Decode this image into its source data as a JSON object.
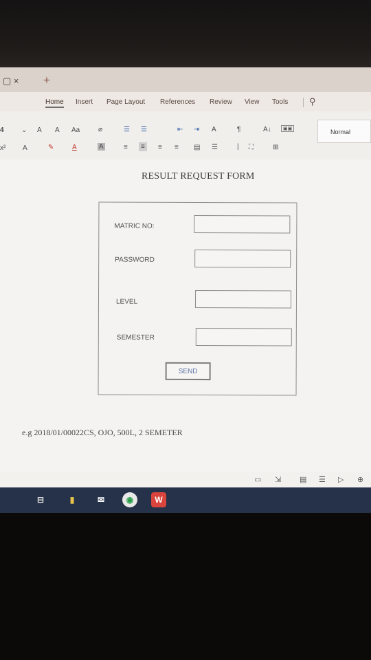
{
  "window": {
    "close_tab_icons": "▢ ×",
    "new_tab_label": "+"
  },
  "menu": {
    "items": [
      "Home",
      "Insert",
      "Page Layout",
      "References",
      "Review",
      "View",
      "Tools"
    ]
  },
  "ribbon": {
    "font_size": "4",
    "grow_font": "A",
    "shrink_font": "A",
    "change_case": "Aa",
    "clear_format": "⌀",
    "row2_script": "x²",
    "font_color_a": "A",
    "highlight": "✎",
    "char_shading": "A",
    "char_border": "A",
    "bullets": "☰",
    "numbering": "☰",
    "indent_dec": "⇤",
    "indent_inc": "⇥",
    "asian_layout": "A",
    "para_mark": "¶",
    "sort": "A↓",
    "align_left": "≡",
    "align_center": "≡",
    "align_right": "≡",
    "justify": "≡",
    "distribute": "▤",
    "line_spacing": "☰",
    "shading": "⛶",
    "borders": "⊞",
    "style_name": "Normal"
  },
  "document": {
    "title": "RESULT REQUEST FORM",
    "fields": [
      {
        "label": "MATRIC NO:",
        "value": ""
      },
      {
        "label": "PASSWORD",
        "value": ""
      },
      {
        "label": "LEVEL",
        "value": ""
      },
      {
        "label": "SEMESTER",
        "value": ""
      }
    ],
    "send_label": "SEND",
    "example": "e.g 2018/01/00022CS, OJO, 500L, 2 SEMETER"
  },
  "statusbar": {
    "icons": [
      "▭",
      "⇲",
      "▤",
      "☰",
      "▷",
      "⊕"
    ]
  },
  "taskbar": {
    "icons": [
      "⊟",
      "▮",
      "✉",
      "◉",
      "W"
    ]
  },
  "colors": {
    "taskbar": "#26324a",
    "app_bg": "#e9e6e2",
    "send_text": "#5b73a6"
  }
}
